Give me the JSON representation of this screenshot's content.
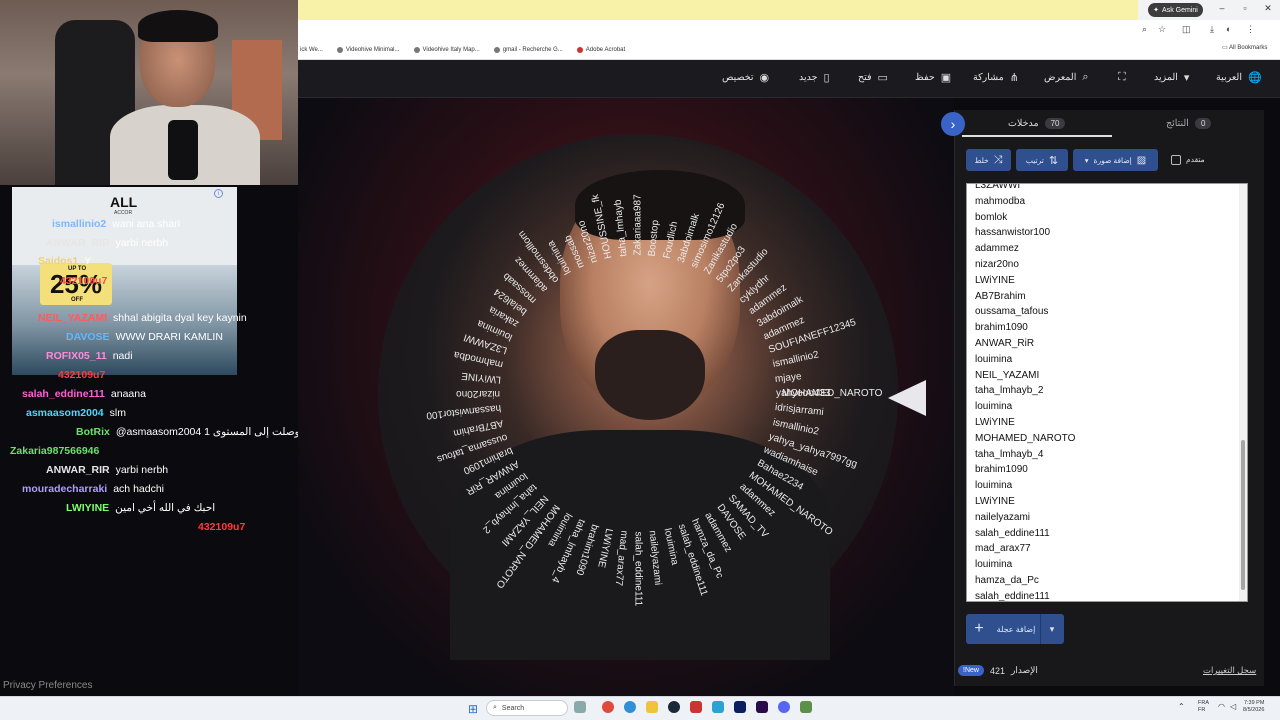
{
  "browser": {
    "ask_gemini": "Ask Gemini",
    "bookmarks": [
      "ick We...",
      "Videohive Minimal...",
      "Videohive Italy Map...",
      "gmail - Recherche G...",
      "Adobe Acrobat"
    ],
    "all_bookmarks": "All Bookmarks"
  },
  "toolbar": {
    "language": "العربية",
    "more": "المزيد",
    "gallery": "المعرض",
    "share": "مشاركة",
    "save": "حفظ",
    "open": "فتح",
    "new": "جديد",
    "customize": "تخصيص"
  },
  "wheel": {
    "names": [
      "Foudlich",
      "3abdoimalk",
      "simosimo12126",
      "Zanikastudio",
      "5tpo2po3",
      "Zankastudio",
      "cyklydhr",
      "adammez",
      "3abdoimalk",
      "adammez",
      "SOUFIANEFF12345",
      "ismallinio2",
      "mjaye",
      "yahyooo433",
      "idrisjarrami",
      "ismallinio2",
      "yahya_yahya7997gg",
      "wadiamhaise",
      "Bahae2234",
      "MOHAMED_NAROTO",
      "adammez",
      "SAMAD_TV",
      "DAVOSE",
      "adammez",
      "hamza_da_Pc",
      "salah_eddine111",
      "louimina",
      "nailelyazami",
      "salah_eddine111",
      "mad_arax77",
      "LWiYINE",
      "brahim1090",
      "taha_lmhayb_4",
      "louimina",
      "MOHAMED_NAROTO",
      "NEIL_YAZAMI",
      "taha_lmhayb_2",
      "louimina",
      "ANWAR_RiR",
      "brahim1090",
      "oussama_tafous",
      "AB7Brahim",
      "hassanwistor100",
      "nizar20no",
      "LWiYINE",
      "mahmodba",
      "L3ZAWWI",
      "louimina",
      "zakaria",
      "belal624",
      "mossaab",
      "adammez",
      "obdesmolllom",
      "louimina",
      "mossab",
      "nizar20no",
      "HOUSSINE_fk",
      "taha_lmhayb",
      "Zakariaaa987",
      "Boostop"
    ],
    "pointer_label": "MOHAMED_NAROTO"
  },
  "panel": {
    "tab_entries_label": "مدخلات",
    "tab_entries_count": "70",
    "tab_results_label": "النتائج",
    "tab_results_count": "0",
    "shuffle": "خلط",
    "sort": "ترتيب",
    "add_image": "إضافة صورة",
    "advanced": "متقدم",
    "entries": [
      "L3ZAWWI",
      "mahmodba",
      "bomlok",
      "hassanwistor100",
      "adammez",
      "nizar20no",
      "LWiYINE",
      "AB7Brahim",
      "oussama_tafous",
      "brahim1090",
      "ANWAR_RiR",
      "louimina",
      "NEIL_YAZAMI",
      "taha_lmhayb_2",
      "louimina",
      "LWiYINE",
      "MOHAMED_NAROTO",
      "taha_lmhayb_4",
      "brahim1090",
      "louimina",
      "LWiYINE",
      "nailelyazami",
      "salah_eddine111",
      "mad_arax77",
      "louimina",
      "hamza_da_Pc",
      "salah_eddine111"
    ],
    "add_quick": "إضافة عجلة",
    "version_label": "الإصدار",
    "version_number": "421",
    "new_badge": "New!",
    "changelog": "سجل التغييرات"
  },
  "ad": {
    "logo": "ALL",
    "logo_sub": "ACCOR",
    "promo": "25%",
    "promo_top": "UP TO",
    "promo_bottom": "OFF"
  },
  "chat": [
    {
      "user": "ismallinio2",
      "msg": "wani ana shari",
      "color": "#7bb7ff"
    },
    {
      "user": "ANWAR_RIR",
      "msg": "yarbi nerbh",
      "color": "#e6e6e6"
    },
    {
      "user": "Saidos1",
      "msg": "Y",
      "color": "#f0d36a"
    },
    {
      "user": "432109u7",
      "msg": "",
      "color": "#ff4a4a"
    },
    {
      "user": "NEIL_YAZAMI",
      "msg": "shhal abigita dyal key kaynin",
      "color": "#ff5b5b"
    },
    {
      "user": "DAVOSE",
      "msg": "WWW DRARI KAMLIN",
      "color": "#5fb8ff"
    },
    {
      "user": "ROFIX05_11",
      "msg": "nadi",
      "color": "#ff8ad8"
    },
    {
      "user": "432109u7",
      "msg": "",
      "color": "#ff3b3b"
    },
    {
      "user": "salah_eddine111",
      "msg": "anaana",
      "color": "#ff5fd0"
    },
    {
      "user": "asmaasom2004",
      "msg": "slm",
      "color": "#47d9ff"
    },
    {
      "user": "BotRix",
      "msg": "@asmaasom2004 مبروك! وصلت إلى المستوى 1",
      "color": "#6be06b"
    },
    {
      "user": "Zakaria987566946",
      "msg": "",
      "color": "#6be06b"
    },
    {
      "user": "ANWAR_RIR",
      "msg": "yarbi nerbh",
      "color": "#e6e6e6"
    },
    {
      "user": "mouradecharraki",
      "msg": "ach hadchi",
      "color": "#b09cff"
    },
    {
      "user": "LWIYINE",
      "msg": "احبك في الله أخي امين",
      "color": "#7cff6b"
    },
    {
      "user": "432109u7",
      "msg": "",
      "color": "#ff3b3b"
    }
  ],
  "privacy": "Privacy Preferences",
  "taskbar": {
    "search": "Search",
    "lang_top": "FRA",
    "lang_bottom": "FR",
    "time": "7:39 PM",
    "date": "8/5/2026"
  }
}
